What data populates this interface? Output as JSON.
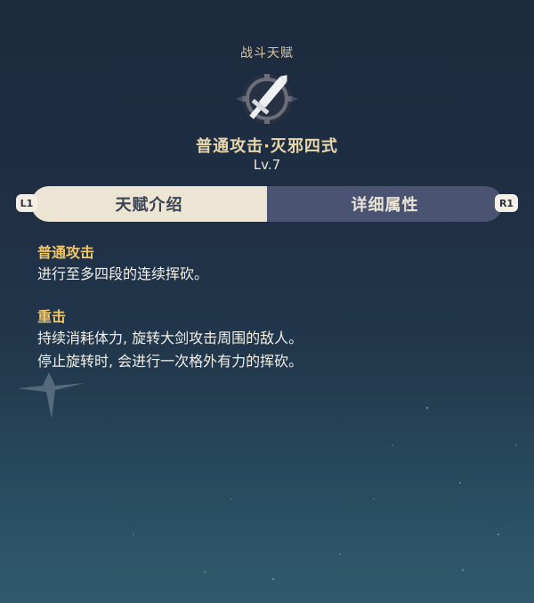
{
  "talent": {
    "category": "战斗天赋",
    "name": "普通攻击·灭邪四式",
    "level": "Lv.7",
    "icon": "sword-icon"
  },
  "tabs": [
    {
      "label": "天赋介绍",
      "active": true
    },
    {
      "label": "详细属性",
      "active": false
    }
  ],
  "controller_hints": {
    "left": "L1",
    "right": "R1"
  },
  "sections": [
    {
      "title": "普通攻击",
      "lines": [
        "进行至多四段的连续挥砍。"
      ]
    },
    {
      "title": "重击",
      "lines": [
        "持续消耗体力, 旋转大剑攻击周围的敌人。",
        "停止旋转时, 会进行一次格外有力的挥砍。"
      ]
    }
  ],
  "colors": {
    "accent_gold": "#f0c76b",
    "tab_active": "#ece5d4",
    "tab_inactive": "#4a5472"
  }
}
